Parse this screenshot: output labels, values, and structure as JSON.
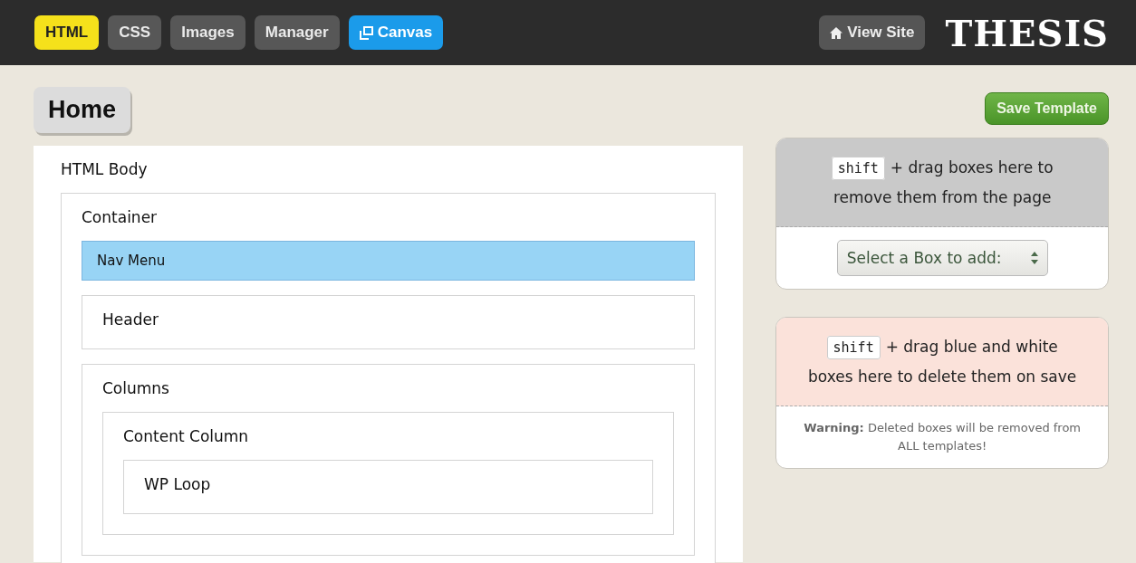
{
  "tabs": [
    {
      "label": "HTML",
      "kind": "plain",
      "selected": true
    },
    {
      "label": "CSS",
      "kind": "plain",
      "selected": false
    },
    {
      "label": "Images",
      "kind": "plain",
      "selected": false
    },
    {
      "label": "Manager",
      "kind": "plain",
      "selected": false
    },
    {
      "label": "Canvas",
      "kind": "canvas",
      "selected": false
    }
  ],
  "view_site": {
    "label": "View Site"
  },
  "logo": "THESIS",
  "page_title": "Home",
  "save_button": "Save Template",
  "tree": {
    "label": "HTML Body",
    "kind": "panel",
    "children": [
      {
        "label": "Container",
        "kind": "box",
        "children": [
          {
            "label": "Nav Menu",
            "kind": "blue"
          },
          {
            "label": "Header",
            "kind": "box"
          },
          {
            "label": "Columns",
            "kind": "box",
            "children": [
              {
                "label": "Content Column",
                "kind": "box",
                "children": [
                  {
                    "label": "WP Loop",
                    "kind": "box"
                  }
                ]
              }
            ]
          }
        ]
      }
    ]
  },
  "drop_zones": [
    {
      "kind": "remove",
      "key": "shift",
      "text_lines": [
        "+ drag boxes here to",
        "remove them from the page"
      ],
      "select": {
        "value": "Select a Box to add:"
      }
    },
    {
      "kind": "delete",
      "key": "shift",
      "text_lines": [
        "+ drag blue and white",
        "boxes here to delete them on save"
      ],
      "note": "**Warning:** Deleted boxes will be removed from ALL templates!"
    }
  ]
}
